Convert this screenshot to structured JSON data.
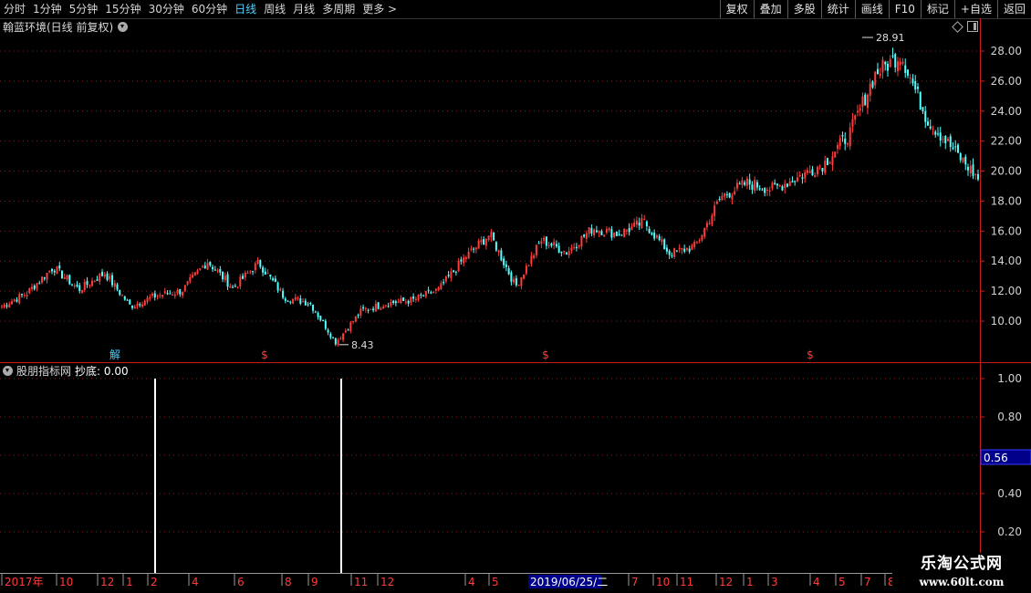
{
  "toolbar": {
    "periods": [
      "分时",
      "1分钟",
      "5分钟",
      "15分钟",
      "30分钟",
      "60分钟",
      "日线",
      "周线",
      "月线",
      "多周期",
      "更多 >"
    ],
    "active_period": "日线",
    "buttons": [
      "复权",
      "叠加",
      "多股",
      "统计",
      "画线",
      "F10",
      "标记",
      "+自选",
      "返回"
    ]
  },
  "main_chart": {
    "title": "翰蓝环境(日线 前复权)",
    "high_label": "28.91",
    "low_label": "8.43",
    "markers": [
      "解",
      "$",
      "$",
      "$"
    ]
  },
  "indicator": {
    "title": "股朋指标网",
    "series_label": "抄底: 0.00",
    "cursor_value": "0.56"
  },
  "date_axis": {
    "labels": [
      "2017年",
      "10",
      "12",
      "1",
      "2",
      "4",
      "6",
      "8",
      "9",
      "11",
      "12",
      "4",
      "5",
      "7",
      "10",
      "11",
      "12",
      "1",
      "3",
      "4",
      "5",
      "7",
      "8",
      "9",
      "1"
    ],
    "cursor_date": "2019/06/25/二"
  },
  "watermark": {
    "title": "乐淘公式网",
    "url": "www.60lt.com"
  },
  "colors": {
    "up": "#ff3c3c",
    "down": "#54ffff",
    "grid": "#8a1e1e",
    "axis": "#c81e1e"
  },
  "chart_data": [
    {
      "type": "candlestick",
      "title": "翰蓝环境(日线 前复权)",
      "y_ticks": [
        "10.00",
        "12.00",
        "14.00",
        "16.00",
        "18.00",
        "20.00",
        "22.00",
        "24.00",
        "26.00",
        "28.00"
      ],
      "ylim": [
        8.0,
        29.5
      ],
      "high": 28.91,
      "low": 8.43,
      "x": [
        "2017-09",
        "2017-10",
        "2017-11",
        "2017-12",
        "2018-01",
        "2018-02",
        "2018-03",
        "2018-04",
        "2018-05",
        "2018-06",
        "2018-07",
        "2018-08",
        "2018-09",
        "2018-10",
        "2018-11",
        "2018-12",
        "2019-01",
        "2019-02",
        "2019-03",
        "2019-04",
        "2019-05",
        "2019-06",
        "2019-07",
        "2019-08",
        "2019-09",
        "2019-10",
        "2019-11",
        "2019-12",
        "2020-01",
        "2020-02",
        "2020-03",
        "2020-04",
        "2020-05",
        "2020-06",
        "2020-07",
        "2020-08",
        "2020-09",
        "2020-10",
        "2020-11"
      ],
      "close": [
        11.0,
        11.9,
        13.6,
        12.1,
        13.2,
        11.0,
        11.7,
        12.0,
        14.0,
        12.2,
        13.9,
        11.6,
        11.2,
        8.6,
        10.7,
        11.2,
        11.4,
        12.1,
        14.2,
        15.8,
        12.3,
        15.4,
        14.6,
        16.2,
        15.8,
        16.6,
        14.5,
        15.0,
        18.3,
        19.2,
        18.8,
        19.6,
        20.5,
        22.5,
        26.5,
        27.8,
        23.5,
        21.5,
        19.5
      ]
    },
    {
      "type": "bar",
      "title": "股朋指标网",
      "series_name": "抄底",
      "y_ticks": [
        "0.20",
        "0.40",
        "0.60",
        "0.80",
        "1.00"
      ],
      "ylim": [
        0,
        1.1
      ],
      "signals": [
        {
          "date": "2018-02",
          "value": 1.0
        },
        {
          "date": "2018-10",
          "value": 1.0
        }
      ]
    }
  ]
}
